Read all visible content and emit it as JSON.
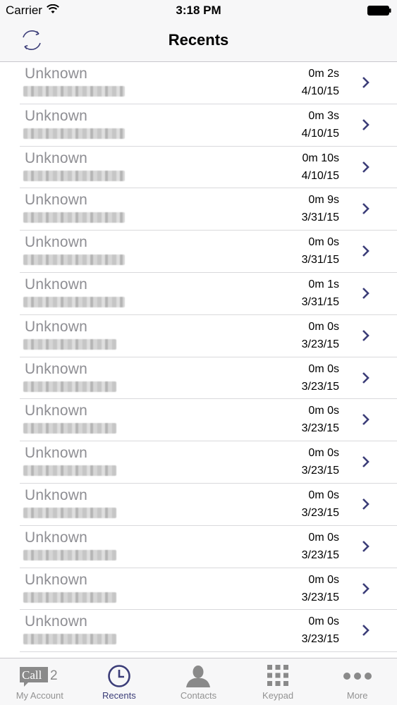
{
  "status_bar": {
    "carrier": "Carrier",
    "time": "3:18 PM"
  },
  "nav": {
    "title": "Recents"
  },
  "recents": [
    {
      "name": "Unknown",
      "duration": "0m 2s",
      "date": "4/10/15"
    },
    {
      "name": "Unknown",
      "duration": "0m 3s",
      "date": "4/10/15"
    },
    {
      "name": "Unknown",
      "duration": "0m 10s",
      "date": "4/10/15"
    },
    {
      "name": "Unknown",
      "duration": "0m 9s",
      "date": "3/31/15"
    },
    {
      "name": "Unknown",
      "duration": "0m 0s",
      "date": "3/31/15"
    },
    {
      "name": "Unknown",
      "duration": "0m 1s",
      "date": "3/31/15"
    },
    {
      "name": "Unknown",
      "duration": "0m 0s",
      "date": "3/23/15"
    },
    {
      "name": "Unknown",
      "duration": "0m 0s",
      "date": "3/23/15"
    },
    {
      "name": "Unknown",
      "duration": "0m 0s",
      "date": "3/23/15"
    },
    {
      "name": "Unknown",
      "duration": "0m 0s",
      "date": "3/23/15"
    },
    {
      "name": "Unknown",
      "duration": "0m 0s",
      "date": "3/23/15"
    },
    {
      "name": "Unknown",
      "duration": "0m 0s",
      "date": "3/23/15"
    },
    {
      "name": "Unknown",
      "duration": "0m 0s",
      "date": "3/23/15"
    },
    {
      "name": "Unknown",
      "duration": "0m 0s",
      "date": "3/23/15"
    }
  ],
  "tabs": [
    {
      "label": "My Account",
      "icon": "call2-logo-icon",
      "active": false,
      "logo_text": "Call",
      "logo_number": "2"
    },
    {
      "label": "Recents",
      "icon": "clock-icon",
      "active": true
    },
    {
      "label": "Contacts",
      "icon": "person-icon",
      "active": false
    },
    {
      "label": "Keypad",
      "icon": "keypad-icon",
      "active": false
    },
    {
      "label": "More",
      "icon": "more-dots-icon",
      "active": false
    }
  ],
  "colors": {
    "accent": "#3b3d78",
    "inactive": "#929292",
    "name_gray": "#8e8e93"
  }
}
